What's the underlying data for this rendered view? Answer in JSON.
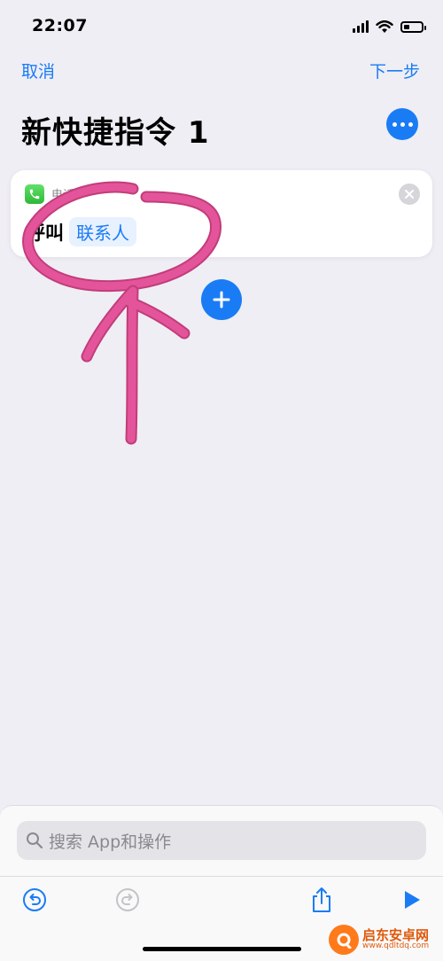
{
  "status_bar": {
    "time": "22:07",
    "battery_level": 0.35
  },
  "nav": {
    "cancel_label": "取消",
    "next_label": "下一步",
    "title": "新快捷指令 1"
  },
  "action_card": {
    "app_name": "电话",
    "verb": "呼叫",
    "parameter": "联系人"
  },
  "search": {
    "placeholder": "搜索 App和操作"
  },
  "toolbar": {
    "icons": [
      "undo-icon",
      "redo-icon",
      "share-icon",
      "play-icon"
    ]
  },
  "watermark": {
    "name": "启东安卓网",
    "url": "www.qdltdq.com"
  },
  "colors": {
    "accent": "#1a7cf5",
    "annotation": "#e4549b",
    "background": "#efeef4"
  }
}
